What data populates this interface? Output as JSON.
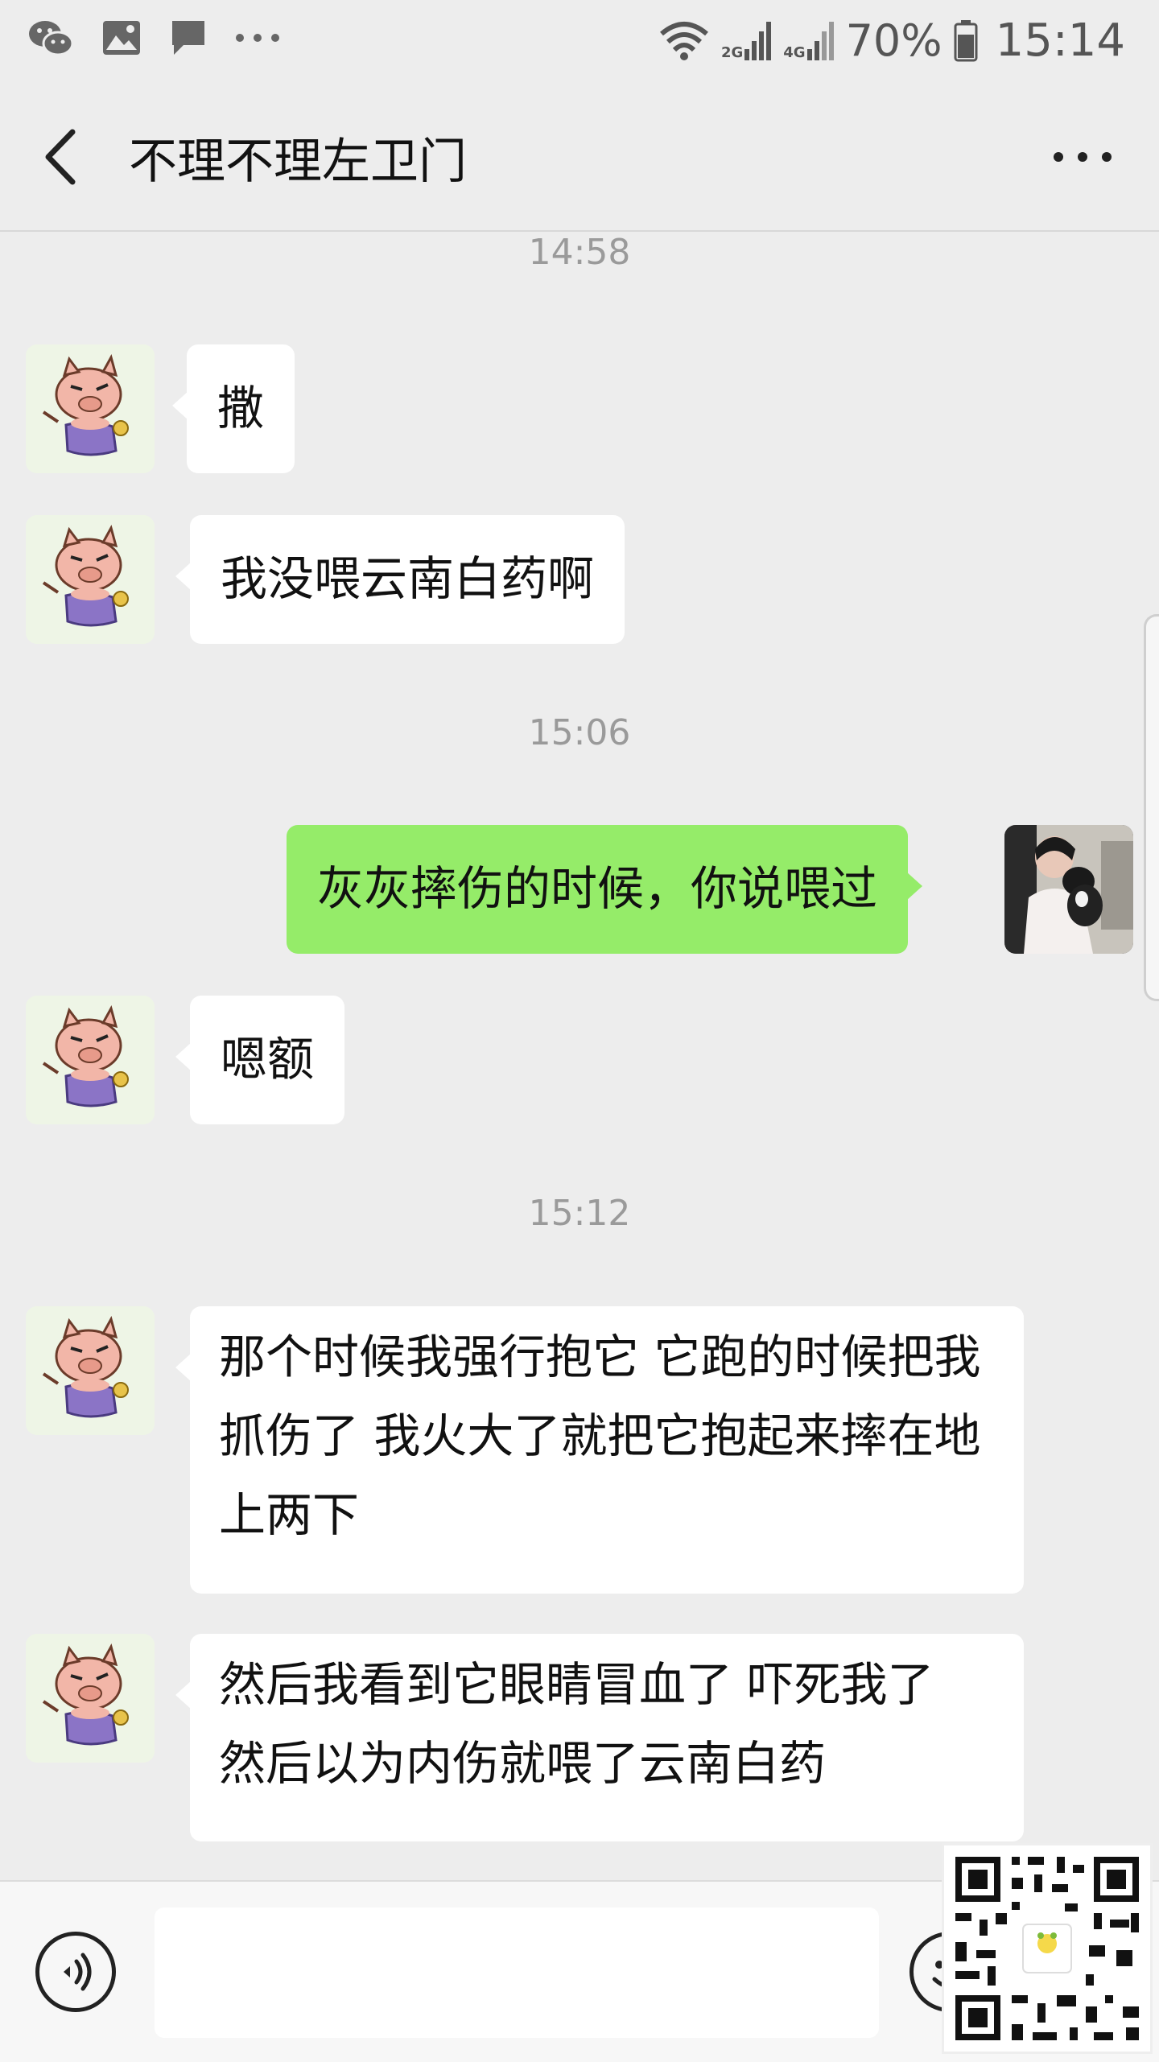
{
  "status_bar": {
    "battery": "70%",
    "time": "15:14",
    "network_2g": "2G",
    "network_4g": "4G"
  },
  "header": {
    "title": "不理不理左卫门"
  },
  "messages": [
    {
      "type": "timestamp",
      "text": "14:58"
    },
    {
      "type": "received",
      "text": "撒"
    },
    {
      "type": "received",
      "text": "我没喂云南白药啊"
    },
    {
      "type": "timestamp",
      "text": "15:06"
    },
    {
      "type": "sent",
      "text": "灰灰摔伤的时候，你说喂过"
    },
    {
      "type": "received",
      "text": "嗯额"
    },
    {
      "type": "timestamp",
      "text": "15:12"
    },
    {
      "type": "received",
      "text": "那个时候我强行抱它  它跑的时候把我抓伤了  我火大了就把它抱起来摔在地上两下"
    },
    {
      "type": "received",
      "text": "然后我看到它眼睛冒血了  吓死我了  然后以为内伤就喂了云南白药"
    }
  ],
  "input": {
    "value": ""
  },
  "colors": {
    "background": "#ededed",
    "sent_bubble": "#95ec69",
    "received_bubble": "#ffffff",
    "timestamp": "#9a9a9a"
  },
  "icons": [
    "wechat-icon",
    "gallery-icon",
    "message-icon",
    "more-dots-icon",
    "wifi-icon",
    "signal-icon",
    "battery-icon",
    "back-arrow-icon",
    "menu-more-icon",
    "voice-icon",
    "emoji-icon"
  ]
}
